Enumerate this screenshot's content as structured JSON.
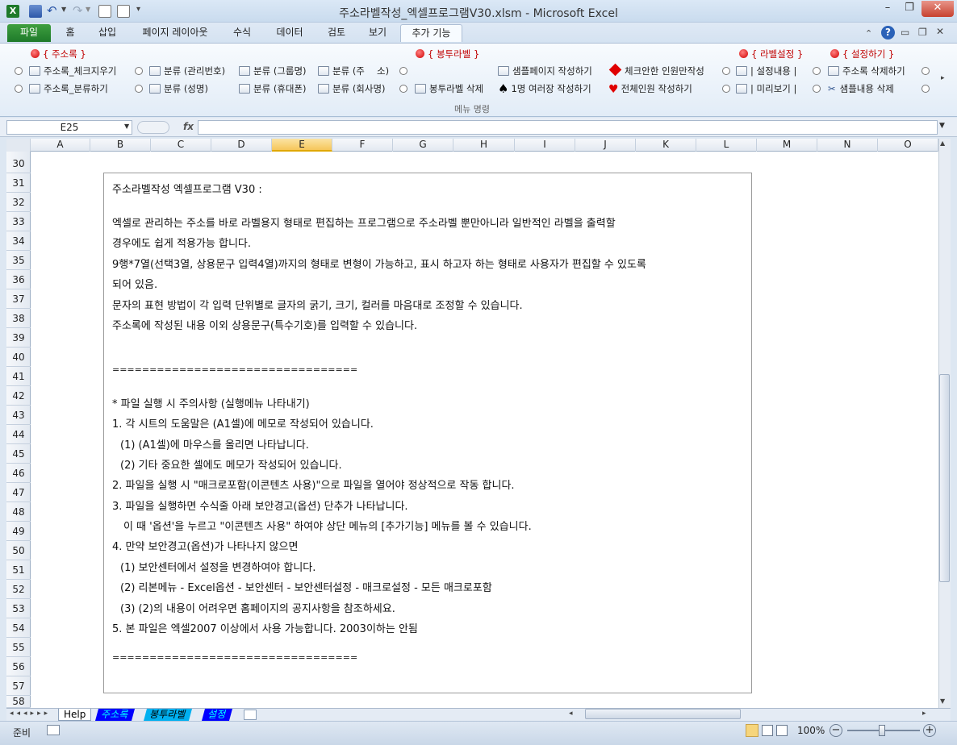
{
  "window": {
    "title": "주소라벨작성_엑셀프로그램V30.xlsm  -  Microsoft Excel",
    "controls": {
      "minimize": "–",
      "restore": "❐",
      "close": "✕"
    }
  },
  "ribbon_tabs": [
    {
      "label": "파일"
    },
    {
      "label": "홈"
    },
    {
      "label": "삽입"
    },
    {
      "label": "페이지 레이아웃"
    },
    {
      "label": "수식"
    },
    {
      "label": "데이터"
    },
    {
      "label": "검토"
    },
    {
      "label": "보기"
    },
    {
      "label": "추가 기능"
    }
  ],
  "ribbon": {
    "group_label": "메뉴 명령",
    "headers": {
      "address_book": "{ 주소록 }",
      "envelope_label": "{ 봉투라벨 }",
      "label_settings": "{ 라벨설정 }",
      "settings": "{ 설정하기 }"
    },
    "buttons": {
      "addr_check": "주소록_체크지우기",
      "addr_classify": "주소록_분류하기",
      "class_mgmt": "분류 (관리번호)",
      "class_name": "분류 (성명)",
      "class_group": "분류 (그룹명)",
      "class_mobile": "분류 (휴대폰)",
      "class_addr": "분류 (주　 소)",
      "class_company": "분류 (회사명)",
      "env_delete": "봉투라벨 삭제",
      "sample_page": "샘플페이지 작성하기",
      "one_multi": "1명 여러장 작성하기",
      "checked_only": "체크안한 인원만작성",
      "all_people": "전체인원 작성하기",
      "setting_content": "| 설정내용 |",
      "preview": "| 미리보기 |",
      "addr_delete": "주소록 삭제하기",
      "sample_delete": "샘플내용 삭제"
    }
  },
  "formula_bar": {
    "name_box": "E25",
    "fx": "fx",
    "value": ""
  },
  "columns": [
    "A",
    "B",
    "C",
    "D",
    "E",
    "F",
    "G",
    "H",
    "I",
    "J",
    "K",
    "L",
    "M",
    "N",
    "O"
  ],
  "selected_column": "E",
  "rows": [
    "30",
    "31",
    "32",
    "33",
    "34",
    "35",
    "36",
    "37",
    "38",
    "39",
    "40",
    "41",
    "42",
    "43",
    "44",
    "45",
    "46",
    "47",
    "48",
    "49",
    "50",
    "51",
    "52",
    "53",
    "54",
    "55",
    "56",
    "57",
    "58"
  ],
  "textbox": {
    "title": "주소라벨작성 엑셀프로그램 V30 :",
    "desc1": "엑셀로 관리하는 주소를 바로 라벨용지 형태로 편집하는 프로그램으로 주소라벨 뿐만아니라 일반적인 라벨을 출력할",
    "desc2": "경우에도 쉽게 적용가능 합니다.",
    "desc3": "9행*7열(선택3열, 상용문구 입력4열)까지의 형태로 변형이 가능하고, 표시 하고자 하는 형태로 사용자가 편집할 수 있도록",
    "desc4": "되어 있음.",
    "desc5": "문자의 표현 방법이 각 입력 단위별로 글자의 굵기, 크기, 컬러를 마음대로 조정할 수 있습니다.",
    "desc6": "주소록에 작성된 내용 이외 상용문구(특수기호)를 입력할 수 있습니다.",
    "sep1": "=================================",
    "note_title": "* 파일 실행 시 주의사항 (실행메뉴 나타내기)",
    "n1": "1. 각 시트의 도움말은 (A1셀)에 메모로 작성되어 있습니다.",
    "n1a": "(1) (A1셀)에 마우스를 올리면 나타납니다.",
    "n1b": "(2) 기타 중요한 셀에도 메모가 작성되어 있습니다.",
    "n2": "2. 파일을 실행 시 \"매크로포함(이콘텐츠 사용)\"으로 파일을 열어야 정상적으로 작동 합니다.",
    "n3": "3. 파일을 실행하면 수식줄 아래 보안경고(옵션) 단추가 나타납니다.",
    "n3a": "이 때 '옵션'을 누르고 \"이콘텐츠 사용\" 하여야 상단 메뉴의 [추가기능] 메뉴를 볼 수 있습니다.",
    "n4": "4. 만약 보안경고(옵션)가 나타나지 않으면",
    "n4a": "(1) 보안센터에서 설정을 변경하여야 합니다.",
    "n4b": "(2) 리본메뉴 - Excel옵션 - 보안센터 - 보안센터설정 - 매크로설정 - 모든 매크로포함",
    "n4c": "(3) (2)의 내용이 어려우면 홈페이지의 공지사항을 참조하세요.",
    "n5": "5. 본 파일은 엑셀2007 이상에서 사용 가능합니다. 2003이하는 안됨",
    "sep2": "================================="
  },
  "sheet_tabs": [
    {
      "label": "Help",
      "color": "#ffffff"
    },
    {
      "label": "주소록",
      "color": "#0000ff"
    },
    {
      "label": "봉투라벨",
      "color": "#00b0f0"
    },
    {
      "label": "설정",
      "color": "#0000ff"
    }
  ],
  "status": {
    "ready": "준비",
    "zoom": "100%"
  }
}
